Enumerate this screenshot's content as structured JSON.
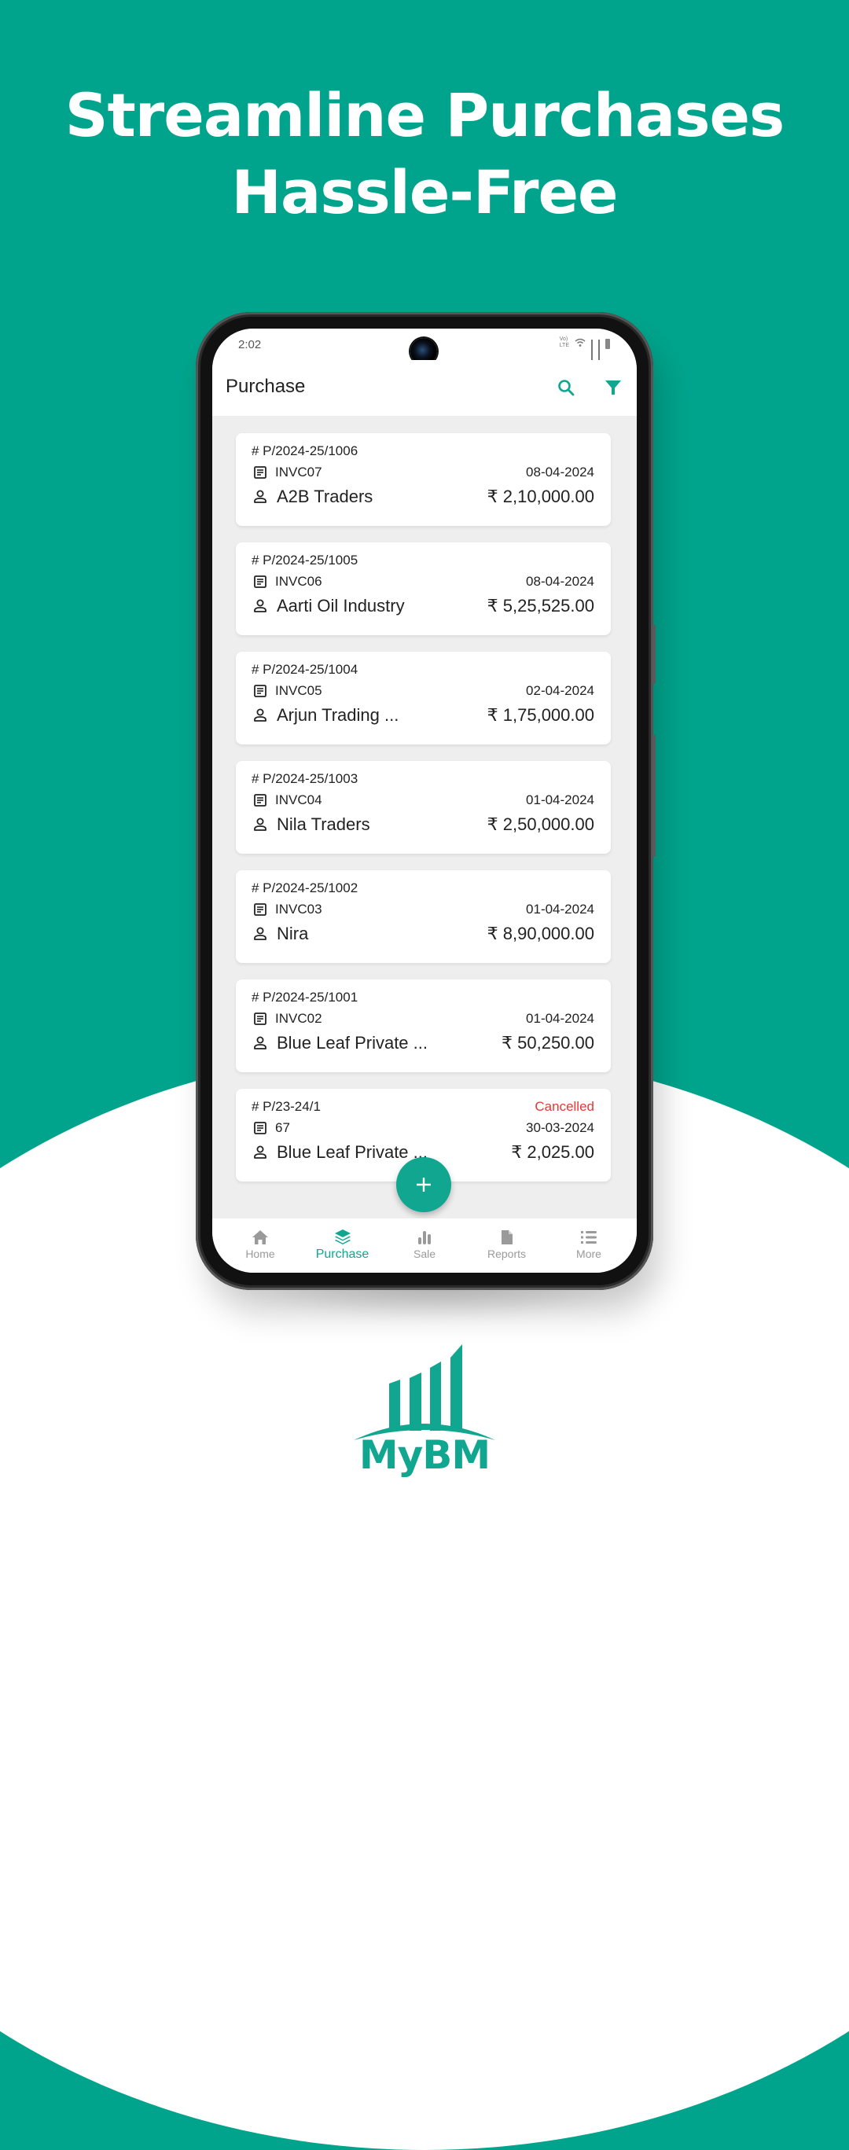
{
  "headline": {
    "line1": "Streamline Purchases",
    "line2": "Hassle-Free"
  },
  "colors": {
    "brand_teal": "#00A48C",
    "accent": "#10A690",
    "cancelled": "#E53935"
  },
  "status_bar": {
    "time": "2:02",
    "network_label": "Vo LTE",
    "icons": [
      "volte-icon",
      "wifi-icon",
      "signal-icon",
      "signal-icon",
      "battery-icon"
    ]
  },
  "app_bar": {
    "title": "Purchase",
    "actions": [
      {
        "name": "search",
        "icon": "search-icon"
      },
      {
        "name": "filter",
        "icon": "filter-icon"
      }
    ]
  },
  "purchases": [
    {
      "number": "# P/2024-25/1006",
      "status": "",
      "invoice": "INVC07",
      "date": "08-04-2024",
      "party": "A2B Traders",
      "amount": "₹ 2,10,000.00"
    },
    {
      "number": "# P/2024-25/1005",
      "status": "",
      "invoice": "INVC06",
      "date": "08-04-2024",
      "party": "Aarti Oil Industry",
      "amount": "₹ 5,25,525.00"
    },
    {
      "number": "# P/2024-25/1004",
      "status": "",
      "invoice": "INVC05",
      "date": "02-04-2024",
      "party": "Arjun Trading ...",
      "amount": "₹ 1,75,000.00"
    },
    {
      "number": "# P/2024-25/1003",
      "status": "",
      "invoice": "INVC04",
      "date": "01-04-2024",
      "party": "Nila Traders",
      "amount": "₹ 2,50,000.00"
    },
    {
      "number": "# P/2024-25/1002",
      "status": "",
      "invoice": "INVC03",
      "date": "01-04-2024",
      "party": "Nira",
      "amount": "₹ 8,90,000.00"
    },
    {
      "number": "# P/2024-25/1001",
      "status": "",
      "invoice": "INVC02",
      "date": "01-04-2024",
      "party": "Blue Leaf Private ...",
      "amount": "₹ 50,250.00"
    },
    {
      "number": "# P/23-24/1",
      "status": "Cancelled",
      "invoice": "67",
      "date": "30-03-2024",
      "party": "Blue Leaf Private ...",
      "amount": "₹ 2,025.00"
    }
  ],
  "fab": {
    "label": "+",
    "icon": "plus-icon"
  },
  "bottom_nav": {
    "active": "Purchase",
    "items": [
      {
        "label": "Home",
        "icon": "home-icon"
      },
      {
        "label": "Purchase",
        "icon": "layers-icon"
      },
      {
        "label": "Sale",
        "icon": "bar-chart-icon"
      },
      {
        "label": "Reports",
        "icon": "document-icon"
      },
      {
        "label": "More",
        "icon": "list-icon"
      }
    ]
  },
  "logo": {
    "text": "MyBM"
  }
}
